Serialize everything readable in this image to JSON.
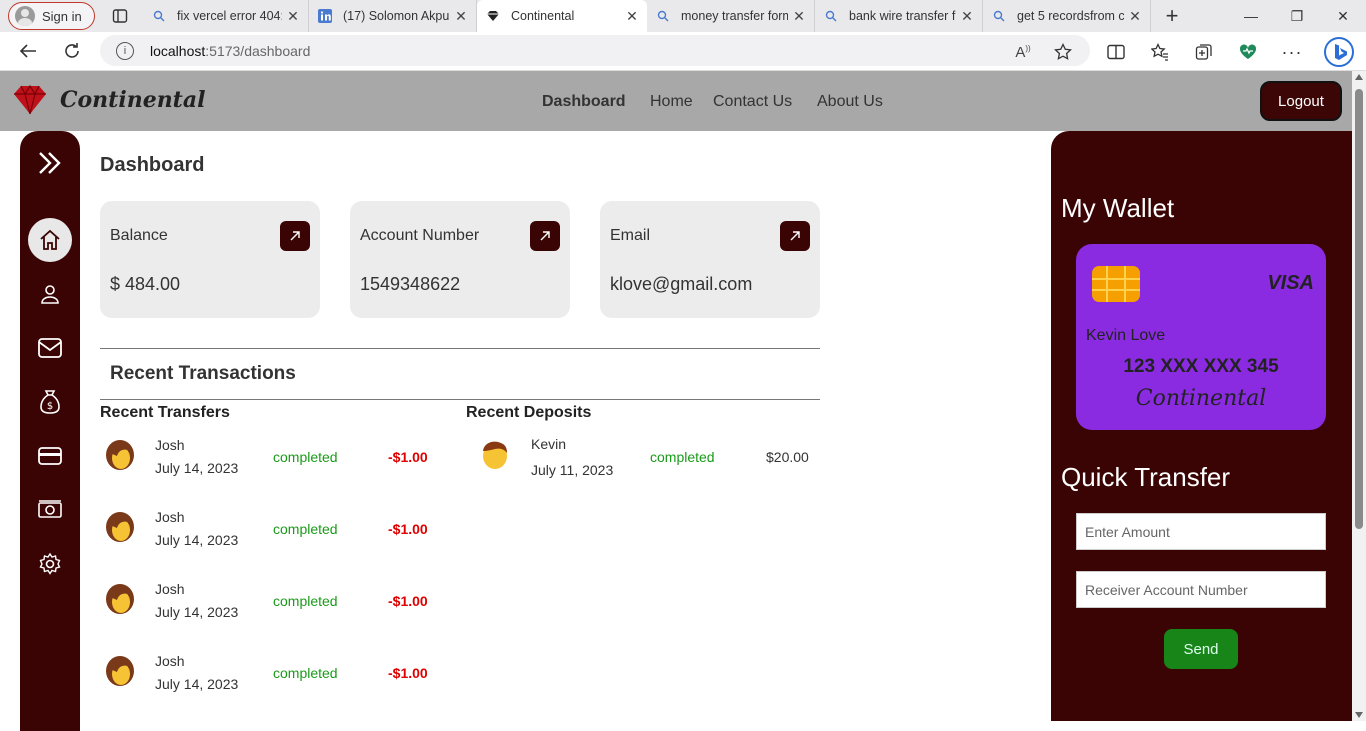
{
  "browser": {
    "signin_label": "Sign in",
    "tabs": [
      {
        "title": "fix vercel error 404:",
        "icon": "search-icon"
      },
      {
        "title": "(17) Solomon Akpu",
        "icon": "linkedin-icon"
      },
      {
        "title": "Continental",
        "icon": "diamond-icon"
      },
      {
        "title": "money transfer form",
        "icon": "search-icon"
      },
      {
        "title": "bank wire transfer f",
        "icon": "search-icon"
      },
      {
        "title": "get 5 recordsfrom c",
        "icon": "search-icon"
      }
    ],
    "url_host": "localhost",
    "url_path": ":5173/dashboard"
  },
  "app": {
    "brand": "Continental",
    "nav": [
      "Dashboard",
      "Home",
      "Contact Us",
      "About Us"
    ],
    "logout_label": "Logout"
  },
  "dashboard": {
    "title": "Dashboard",
    "cards": [
      {
        "label": "Balance",
        "value": "$ 484.00"
      },
      {
        "label": "Account Number",
        "value": "1549348622"
      },
      {
        "label": "Email",
        "value": "klove@gmail.com"
      }
    ],
    "recent_title": "Recent Transactions",
    "transfers_title": "Recent Transfers",
    "deposits_title": "Recent Deposits",
    "transfers": [
      {
        "name": "Josh",
        "date": "July 14, 2023",
        "status": "completed",
        "amount": "-$1.00"
      },
      {
        "name": "Josh",
        "date": "July 14, 2023",
        "status": "completed",
        "amount": "-$1.00"
      },
      {
        "name": "Josh",
        "date": "July 14, 2023",
        "status": "completed",
        "amount": "-$1.00"
      },
      {
        "name": "Josh",
        "date": "July 14, 2023",
        "status": "completed",
        "amount": "-$1.00"
      }
    ],
    "deposits": [
      {
        "name": "Kevin",
        "date": "July 11, 2023",
        "status": "completed",
        "amount": "$20.00"
      }
    ]
  },
  "wallet": {
    "title": "My Wallet",
    "card_brand": "VISA",
    "holder": "Kevin Love",
    "card_number": "123 XXX XXX 345",
    "card_bank": "Continental",
    "card_color": "#8a2be2"
  },
  "quick_transfer": {
    "title": "Quick Transfer",
    "amount_placeholder": "Enter Amount",
    "account_placeholder": "Receiver Account Number",
    "send_label": "Send"
  },
  "colors": {
    "accent": "#3b0404",
    "header": "#a8a8a8",
    "success": "#1a9a1a",
    "debit": "#e00000",
    "send": "#178517"
  }
}
